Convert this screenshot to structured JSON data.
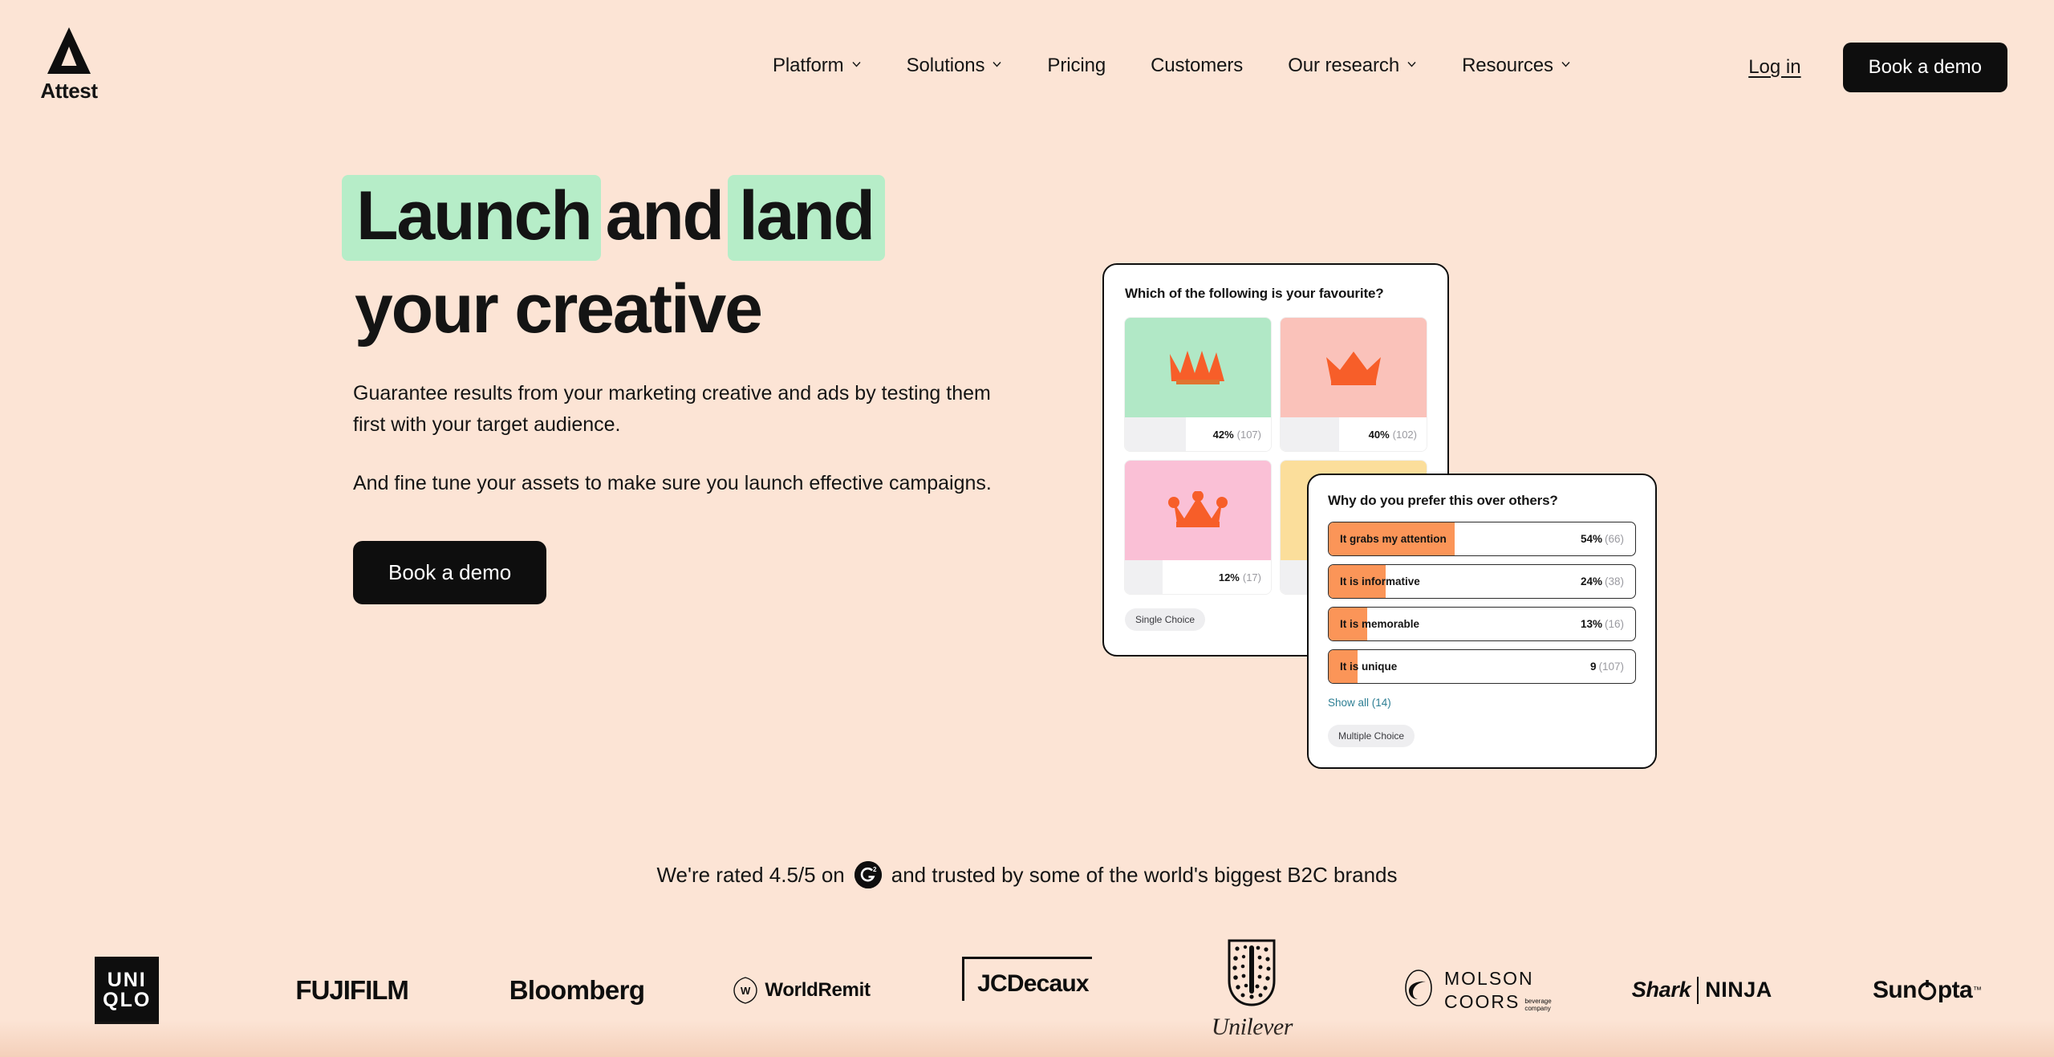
{
  "brand": {
    "name": "Attest",
    "logo_icon": "triangle-logo-icon"
  },
  "header": {
    "nav": [
      {
        "label": "Platform",
        "has_dropdown": true
      },
      {
        "label": "Solutions",
        "has_dropdown": true
      },
      {
        "label": "Pricing",
        "has_dropdown": false
      },
      {
        "label": "Customers",
        "has_dropdown": false
      },
      {
        "label": "Our research",
        "has_dropdown": true
      },
      {
        "label": "Resources",
        "has_dropdown": true
      }
    ],
    "login_label": "Log in",
    "cta_label": "Book a demo"
  },
  "hero": {
    "headline": {
      "mark1": "Launch",
      "plain1": "and",
      "mark2": "land",
      "line2": "your creative"
    },
    "paragraph1": "Guarantee results from your marketing creative and ads by testing them first with your target audience.",
    "paragraph2": "And fine tune your assets to make sure you launch effective campaigns.",
    "cta_label": "Book a demo"
  },
  "survey_card_1": {
    "question": "Which of the following is your favourite?",
    "tag": "Single Choice",
    "options": [
      {
        "swatch": "#B1E8C6",
        "percent": "42%",
        "count": "(107)",
        "fill_pct": 42,
        "crown": "crown-spiky-icon"
      },
      {
        "swatch": "#FAC2BA",
        "percent": "40%",
        "count": "(102)",
        "fill_pct": 40,
        "crown": "crown-wide-icon"
      },
      {
        "swatch": "#FAC0D6",
        "percent": "12%",
        "count": "(17)",
        "fill_pct": 26,
        "crown": "crown-ball-icon"
      },
      {
        "swatch": "#FBDE9B",
        "percent": "",
        "count": "",
        "fill_pct": 30,
        "crown": "crown-hidden-icon"
      }
    ]
  },
  "survey_card_2": {
    "question": "Why do you prefer this over others?",
    "tag": "Multiple Choice",
    "show_all_label": "Show all (14)",
    "options": [
      {
        "label": "It grabs my attention",
        "percent": "54%",
        "count": "(66)",
        "fill_pct": 41
      },
      {
        "label": "It is informative",
        "percent": "24%",
        "count": "(38)",
        "fill_pct": 18.5
      },
      {
        "label": "It is memorable",
        "percent": "13%",
        "count": "(16)",
        "fill_pct": 12.5
      },
      {
        "label": "It is unique",
        "percent": "9",
        "count": "(107)",
        "fill_pct": 9.5
      }
    ]
  },
  "rating": {
    "prefix": "We're rated 4.5/5 on",
    "icon": "g2-badge-icon",
    "suffix": "and trusted by some of the world's biggest B2C brands"
  },
  "brands": {
    "uniqlo_line1": "UNI",
    "uniqlo_line2": "QLO",
    "fujifilm": "FUJIFILM",
    "bloomberg": "Bloomberg",
    "worldremit": "WorldRemit",
    "worldremit_mark": "W",
    "jcdecaux": "JCDecaux",
    "unilever": "Unilever",
    "molson_line1": "MOLSON",
    "molson_line2": "COORS",
    "molson_sub1": "beverage",
    "molson_sub2": "company",
    "shark": "Shark",
    "ninja": "NINJA",
    "sunopta_a": "Sun",
    "sunopta_b": "pta",
    "sunopta_tm": "™"
  },
  "colors": {
    "page_bg": "#FCE4D5",
    "ink": "#141414",
    "highlight_green": "#B6EDC8",
    "orange": "#F75E29",
    "bar_orange": "#FB9558",
    "link_teal": "#2E7F94"
  }
}
